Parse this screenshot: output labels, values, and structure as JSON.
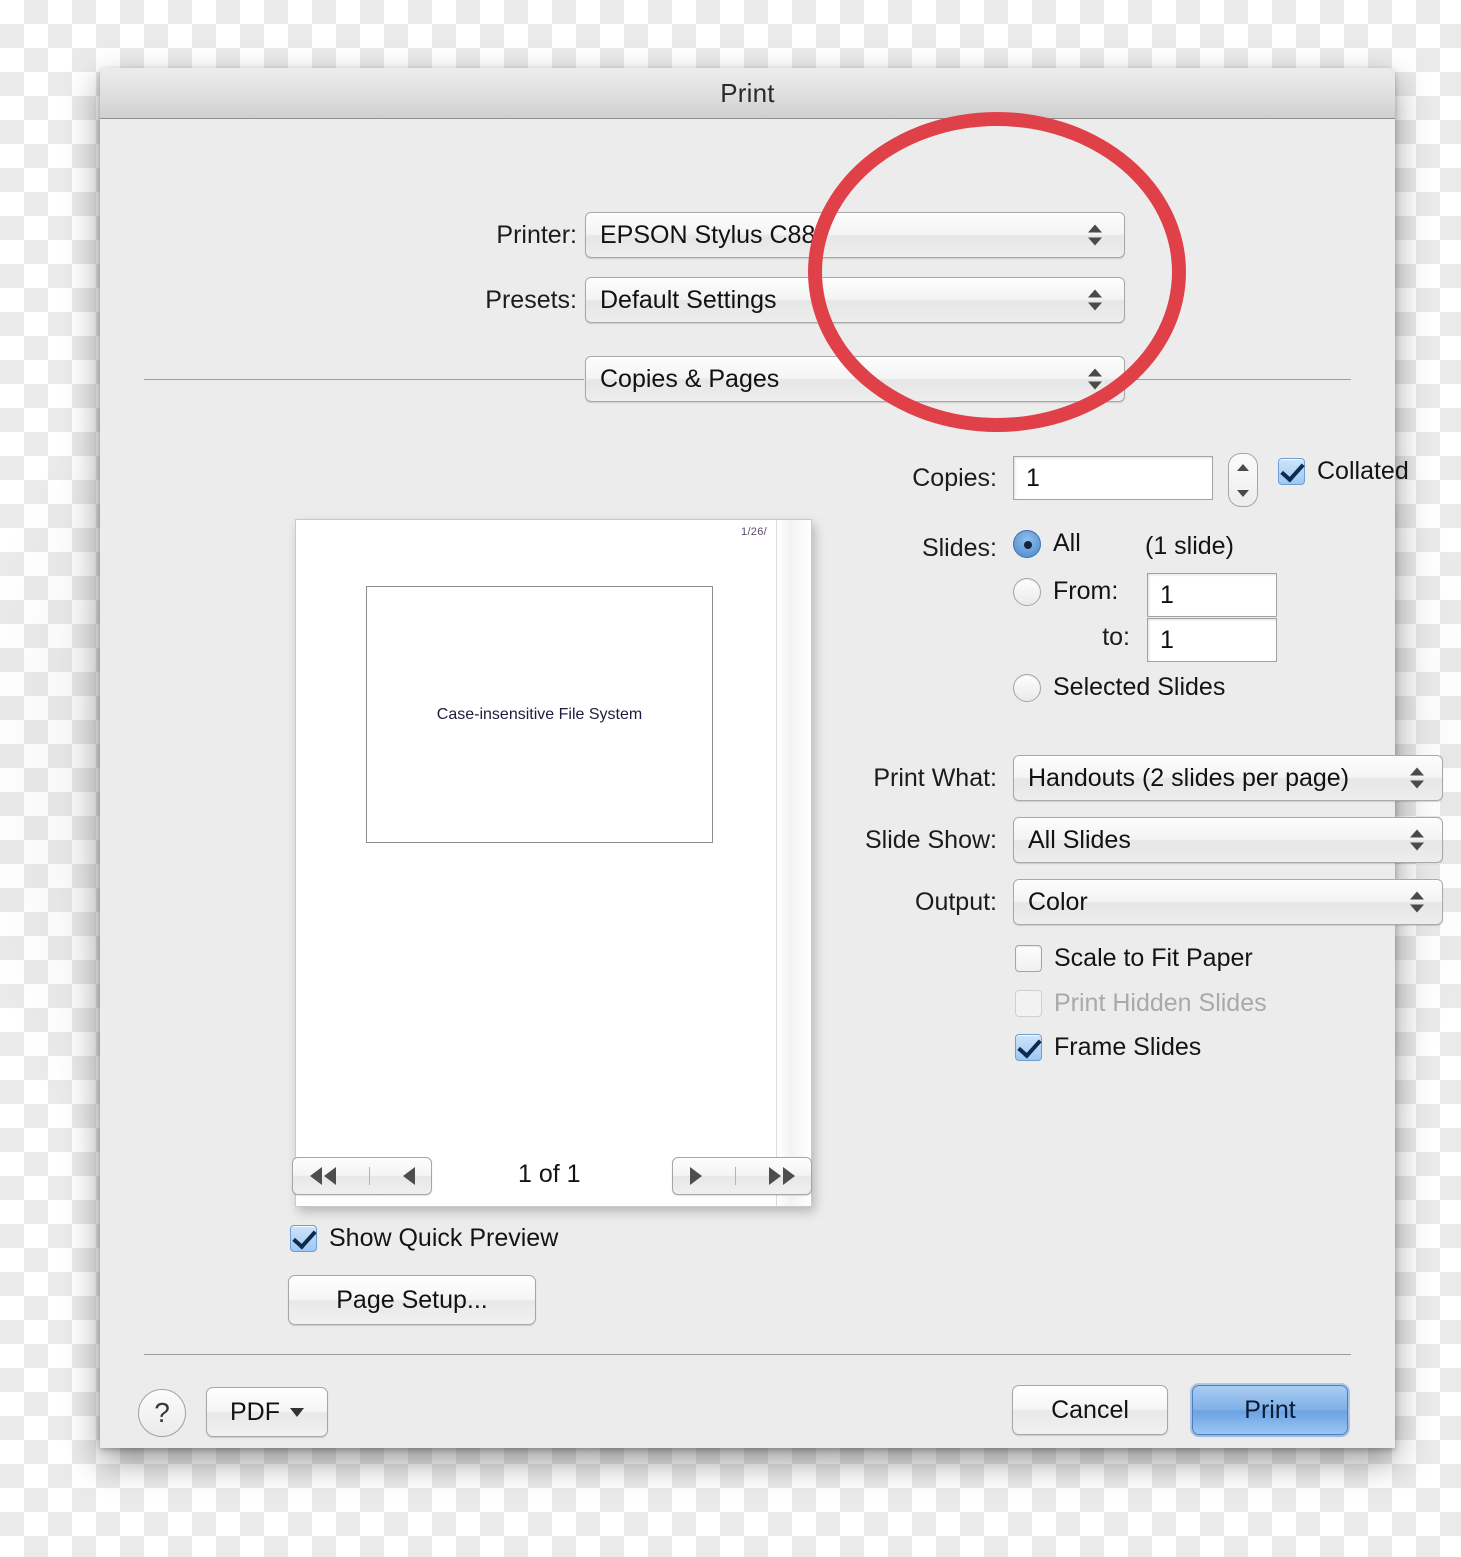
{
  "window": {
    "title": "Print"
  },
  "fields": {
    "printer_label": "Printer:",
    "printer_value": "EPSON Stylus C88",
    "presets_label": "Presets:",
    "presets_value": "Default Settings",
    "pane_value": "Copies & Pages"
  },
  "copies": {
    "label": "Copies:",
    "value": "1",
    "collated_label": "Collated",
    "collated_checked": true
  },
  "slides": {
    "label": "Slides:",
    "all_label": "All",
    "all_selected": true,
    "count_note": "(1 slide)",
    "from_label": "From:",
    "from_value": "1",
    "from_selected": false,
    "to_label": "to:",
    "to_value": "1",
    "selected_slides_label": "Selected Slides",
    "selected_slides_selected": false
  },
  "options": {
    "print_what_label": "Print What:",
    "print_what_value": "Handouts (2 slides per page)",
    "slide_show_label": "Slide Show:",
    "slide_show_value": "All Slides",
    "output_label": "Output:",
    "output_value": "Color",
    "scale_to_fit_label": "Scale to Fit Paper",
    "scale_to_fit_checked": false,
    "print_hidden_label": "Print Hidden Slides",
    "print_hidden_checked": false,
    "print_hidden_disabled": true,
    "frame_slides_label": "Frame Slides",
    "frame_slides_checked": true
  },
  "preview": {
    "slide_title": "Case-insensitive File System",
    "corner_stamp": "1/26/",
    "page_indicator": "1 of 1",
    "show_quick_preview_label": "Show Quick Preview",
    "show_quick_preview_checked": true,
    "page_setup_label": "Page Setup..."
  },
  "footer": {
    "help_label": "?",
    "pdf_label": "PDF",
    "cancel_label": "Cancel",
    "print_label": "Print"
  },
  "annotation": {
    "shape": "ellipse",
    "color": "#e04048"
  }
}
